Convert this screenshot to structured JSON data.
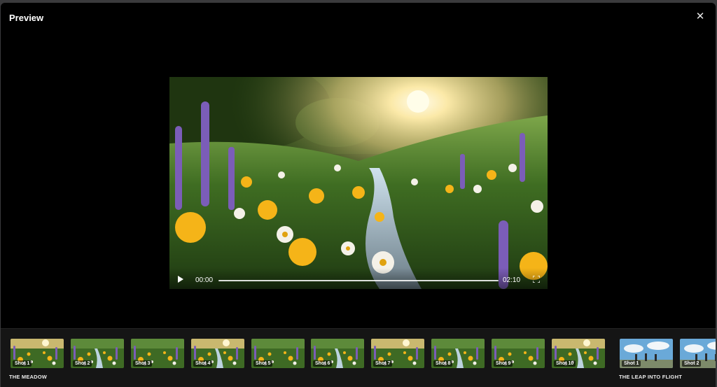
{
  "modal": {
    "title": "Preview",
    "close_icon": "close-icon"
  },
  "player": {
    "current_time": "00:00",
    "total_time": "02:10",
    "progress": 0,
    "play_icon": "play-icon",
    "fullscreen_icon": "fullscreen-icon"
  },
  "filmstrip": {
    "groups": [
      {
        "label": "THE MEADOW"
      },
      {
        "label": "THE LEAP INTO FLIGHT"
      }
    ],
    "shots": [
      {
        "label": "Shot 1",
        "scene": "meadow"
      },
      {
        "label": "Shot 2",
        "scene": "meadow"
      },
      {
        "label": "Shot 3",
        "scene": "meadow"
      },
      {
        "label": "Shot 4",
        "scene": "meadow"
      },
      {
        "label": "Shot 5",
        "scene": "meadow"
      },
      {
        "label": "Shot 6",
        "scene": "meadow"
      },
      {
        "label": "Shot 7",
        "scene": "meadow"
      },
      {
        "label": "Shot 8",
        "scene": "meadow"
      },
      {
        "label": "Shot 9",
        "scene": "meadow"
      },
      {
        "label": "Shot 10",
        "scene": "meadow"
      },
      {
        "label": "Shot 1",
        "scene": "sky"
      },
      {
        "label": "Shot 2",
        "scene": "sky"
      }
    ]
  },
  "colors": {
    "modal_bg": "#000000",
    "filmstrip_bg": "#151515",
    "lavender": "#7b5db8",
    "yellow_flower": "#f5b418",
    "grass": "#4f8a2c",
    "sky_blue": "#6aa9d8"
  }
}
